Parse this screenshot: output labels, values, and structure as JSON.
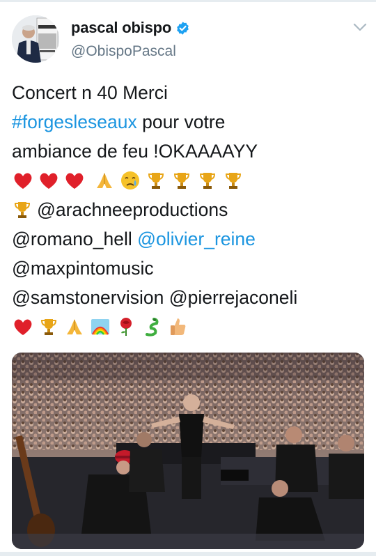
{
  "tweet": {
    "author": {
      "display_name": "pascal obispo",
      "handle": "@ObispoPascal",
      "verified": true,
      "avatar_icon": "avatar-photo"
    },
    "menu_icon": "chevron-down-icon",
    "text_lines": [
      [
        "Concert n 40 Merci"
      ],
      [
        "#forgesleseaux",
        " pour votre"
      ],
      [
        "ambiance de feu !OKAAAAYY"
      ],
      [
        "@arachneeproductions"
      ],
      [
        "@romano_hell ",
        "@olivier_reine"
      ],
      [
        "@maxpintomusic"
      ],
      [
        "@samstonervision @pierrejaconeli"
      ]
    ],
    "emoji_row_1": [
      "heart",
      "heart",
      "heart",
      "folded-hands",
      "crying-face",
      "trophy",
      "trophy",
      "trophy",
      "trophy"
    ],
    "emoji_line_4_prefix": [
      "trophy"
    ],
    "emoji_row_2": [
      "heart",
      "trophy",
      "folded-hands",
      "rainbow",
      "rose",
      "dragon",
      "thumbs-up"
    ],
    "media": {
      "kind": "concert-crowd-photo"
    },
    "colors": {
      "link": "#1b95e0",
      "verified": "#1da1f2",
      "handle": "#657786",
      "text": "#14171a"
    }
  }
}
